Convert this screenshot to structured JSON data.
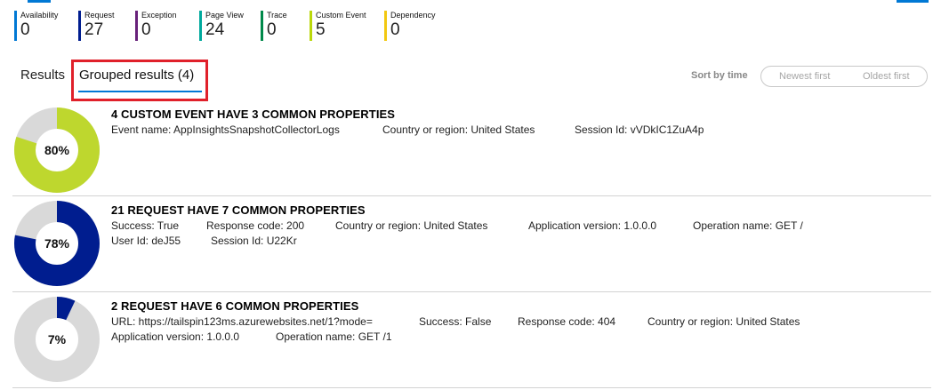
{
  "counters": [
    {
      "label": "Availability",
      "value": "0",
      "color": "#0078d4"
    },
    {
      "label": "Request",
      "value": "27",
      "color": "#001d8f"
    },
    {
      "label": "Exception",
      "value": "0",
      "color": "#68217a"
    },
    {
      "label": "Page View",
      "value": "24",
      "color": "#00a99d"
    },
    {
      "label": "Trace",
      "value": "0",
      "color": "#00894a"
    },
    {
      "label": "Custom Event",
      "value": "5",
      "color": "#bad80a"
    },
    {
      "label": "Dependency",
      "value": "0",
      "color": "#f2c811"
    }
  ],
  "tabs": {
    "results": "Results",
    "grouped": "Grouped results (4)"
  },
  "sort": {
    "label": "Sort by time",
    "newest": "Newest first",
    "oldest": "Oldest first"
  },
  "groups": [
    {
      "title": "4 CUSTOM EVENT HAVE 3 COMMON PROPERTIES",
      "percent_label": "80%",
      "fraction": 0.8,
      "color": "#bed72e",
      "lines": [
        [
          "Event name: AppInsightsSnapshotCollectorLogs",
          "Country or region: United States",
          "Session Id: vVDkIC1ZuA4p"
        ]
      ]
    },
    {
      "title": "21 REQUEST HAVE 7 COMMON PROPERTIES",
      "percent_label": "78%",
      "fraction": 0.78,
      "color": "#001d8f",
      "lines": [
        [
          "Success: True",
          "Response code: 200",
          "Country or region: United States",
          "Application version: 1.0.0.0",
          "Operation name: GET /"
        ],
        [
          "User Id: deJ55",
          "Session Id: U22Kr"
        ]
      ]
    },
    {
      "title": "2 REQUEST HAVE 6 COMMON PROPERTIES",
      "percent_label": "7%",
      "fraction": 0.07,
      "color": "#001d8f",
      "lines": [
        [
          "URL: https://tailspin123ms.azurewebsites.net/1?mode=",
          "Success: False",
          "Response code: 404",
          "Country or region: United States"
        ],
        [
          "Application version: 1.0.0.0",
          "Operation name: GET /1"
        ]
      ]
    }
  ],
  "colors": {
    "accent": "#0078d4",
    "donut_remainder": "#d9d9d9",
    "highlight": "#e0202a"
  }
}
